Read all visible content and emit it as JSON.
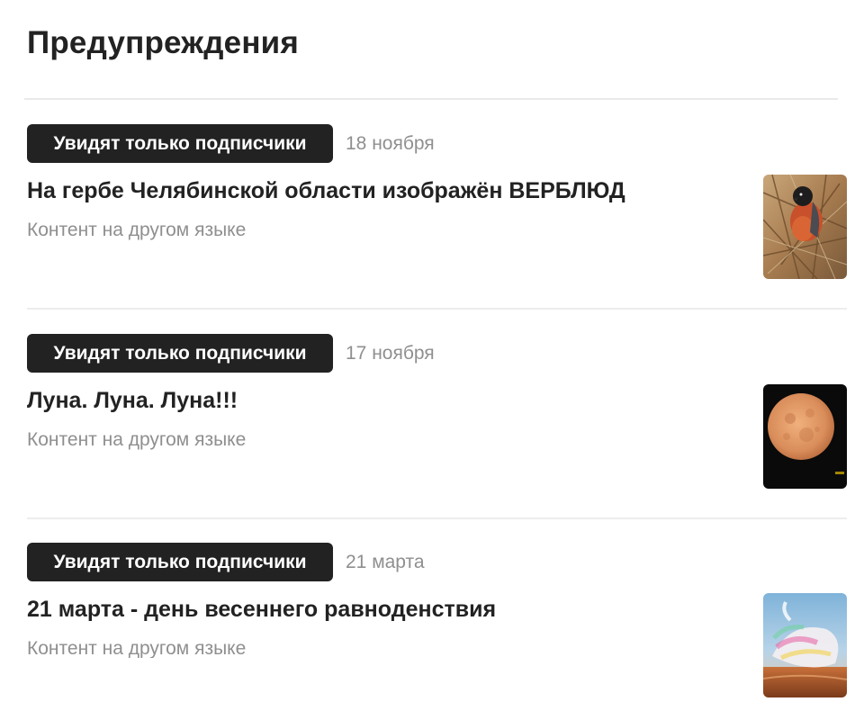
{
  "header": {
    "title": "Предупреждения"
  },
  "posts": [
    {
      "badge": "Увидят только подписчики",
      "date": "18 ноября",
      "title": "На гербе Челябинской области изображён ВЕРБЛЮД",
      "subtitle": "Контент на другом языке",
      "thumbnail_icon": "bird-photo"
    },
    {
      "badge": "Увидят только подписчики",
      "date": "17 ноября",
      "title": "Луна. Луна. Луна!!!",
      "subtitle": "Контент на другом языке",
      "thumbnail_icon": "moon-photo"
    },
    {
      "badge": "Увидят только подписчики",
      "date": "21 марта",
      "title": "21 марта - день весеннего равноденствия",
      "subtitle": "Контент на другом языке",
      "thumbnail_icon": "swan-photo"
    }
  ],
  "colors": {
    "badge_background": "#222222",
    "badge_text": "#ffffff",
    "muted_text": "#8f8f8f",
    "divider": "#ededed"
  }
}
